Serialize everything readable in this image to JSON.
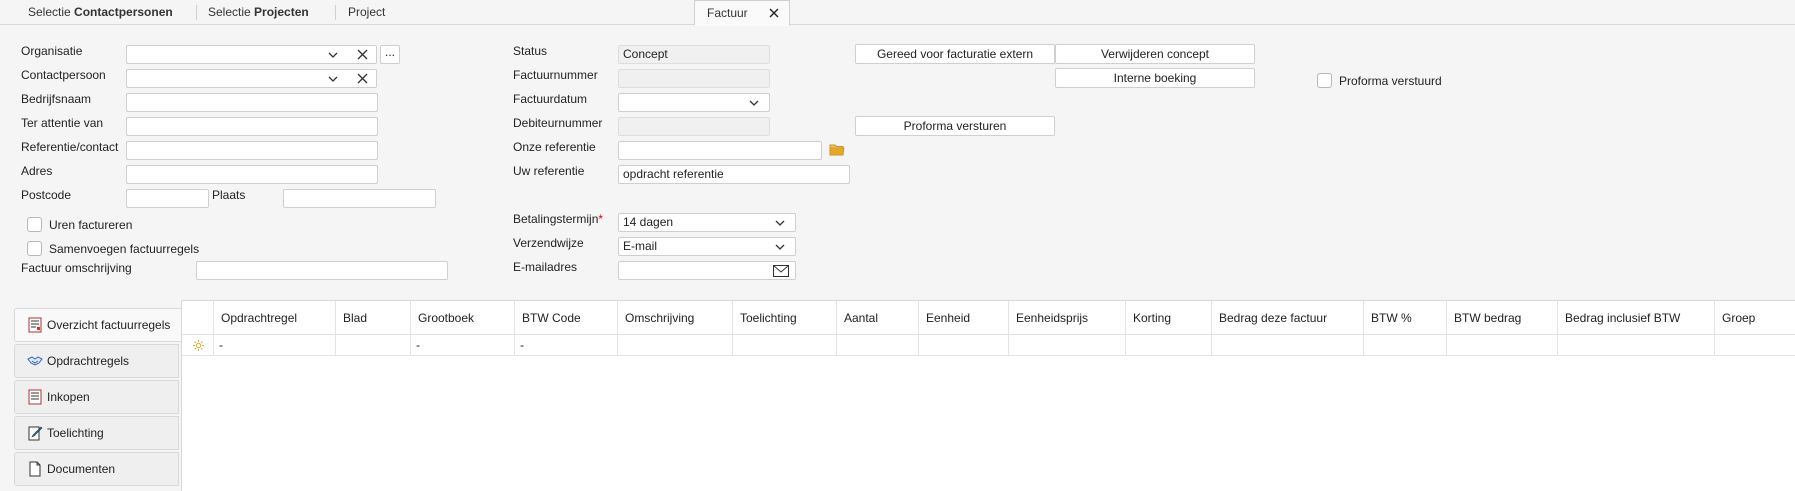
{
  "tabs": [
    {
      "prefix": "Selectie ",
      "bold": "Contactpersonen"
    },
    {
      "prefix": "Selectie ",
      "bold": "Projecten"
    },
    {
      "prefix": "Project",
      "bold": ""
    },
    {
      "prefix": "Factuur",
      "bold": "",
      "active": true
    }
  ],
  "left_form": {
    "organisatie": {
      "label": "Organisatie",
      "value": "",
      "more_label": "..."
    },
    "contactpersoon": {
      "label": "Contactpersoon",
      "value": ""
    },
    "bedrijfsnaam": {
      "label": "Bedrijfsnaam",
      "value": ""
    },
    "ter_attentie_van": {
      "label": "Ter attentie van",
      "value": ""
    },
    "referentie_contact": {
      "label": "Referentie/contact",
      "value": ""
    },
    "adres": {
      "label": "Adres",
      "value": ""
    },
    "postcode": {
      "label": "Postcode",
      "value": ""
    },
    "plaats": {
      "label": "Plaats",
      "value": ""
    },
    "uren_factureren": {
      "label": "Uren factureren",
      "checked": false
    },
    "samenvoegen": {
      "label": "Samenvoegen factuurregels",
      "checked": false
    },
    "factuur_omschrijving": {
      "label": "Factuur omschrijving",
      "value": ""
    }
  },
  "mid_form": {
    "status": {
      "label": "Status",
      "value": "Concept"
    },
    "factuurnummer": {
      "label": "Factuurnummer",
      "value": ""
    },
    "factuurdatum": {
      "label": "Factuurdatum",
      "value": ""
    },
    "debiteurnummer": {
      "label": "Debiteurnummer",
      "value": ""
    },
    "onze_referentie": {
      "label": "Onze referentie",
      "value": ""
    },
    "uw_referentie": {
      "label": "Uw referentie",
      "value": "opdracht referentie"
    },
    "betalingstermijn": {
      "label": "Betalingstermijn",
      "required_mark": "*",
      "value": "14 dagen"
    },
    "verzendwijze": {
      "label": "Verzendwijze",
      "value": "E-mail"
    },
    "emailadres": {
      "label": "E-mailadres",
      "value": ""
    }
  },
  "buttons": {
    "gereed": "Gereed voor facturatie extern",
    "verwijderen": "Verwijderen concept",
    "interne_boeking": "Interne boeking",
    "proforma_versturen": "Proforma versturen"
  },
  "proforma_verstuurd": {
    "label": "Proforma verstuurd",
    "checked": false
  },
  "side_tabs": [
    {
      "label": "Overzicht factuurregels",
      "icon": "invoice-list-icon",
      "active": true
    },
    {
      "label": "Opdrachtregels",
      "icon": "handshake-icon"
    },
    {
      "label": "Inkopen",
      "icon": "purchase-list-icon"
    },
    {
      "label": "Toelichting",
      "icon": "edit-note-icon"
    },
    {
      "label": "Documenten",
      "icon": "document-icon"
    }
  ],
  "grid": {
    "columns": [
      "Opdrachtregel",
      "Blad",
      "Grootboek",
      "BTW Code",
      "Omschrijving",
      "Toelichting",
      "Aantal",
      "Eenheid",
      "Eenheidsprijs",
      "Korting",
      "Bedrag deze factuur",
      "BTW %",
      "BTW bedrag",
      "Bedrag inclusief BTW",
      "Groep"
    ],
    "new_row": [
      "-",
      "",
      "-",
      "-",
      "",
      "",
      "",
      "",
      "",
      "",
      "",
      "",
      "",
      "",
      ""
    ]
  },
  "colors": {
    "accent_required": "#dd0000",
    "folder": "#e5a92a"
  }
}
